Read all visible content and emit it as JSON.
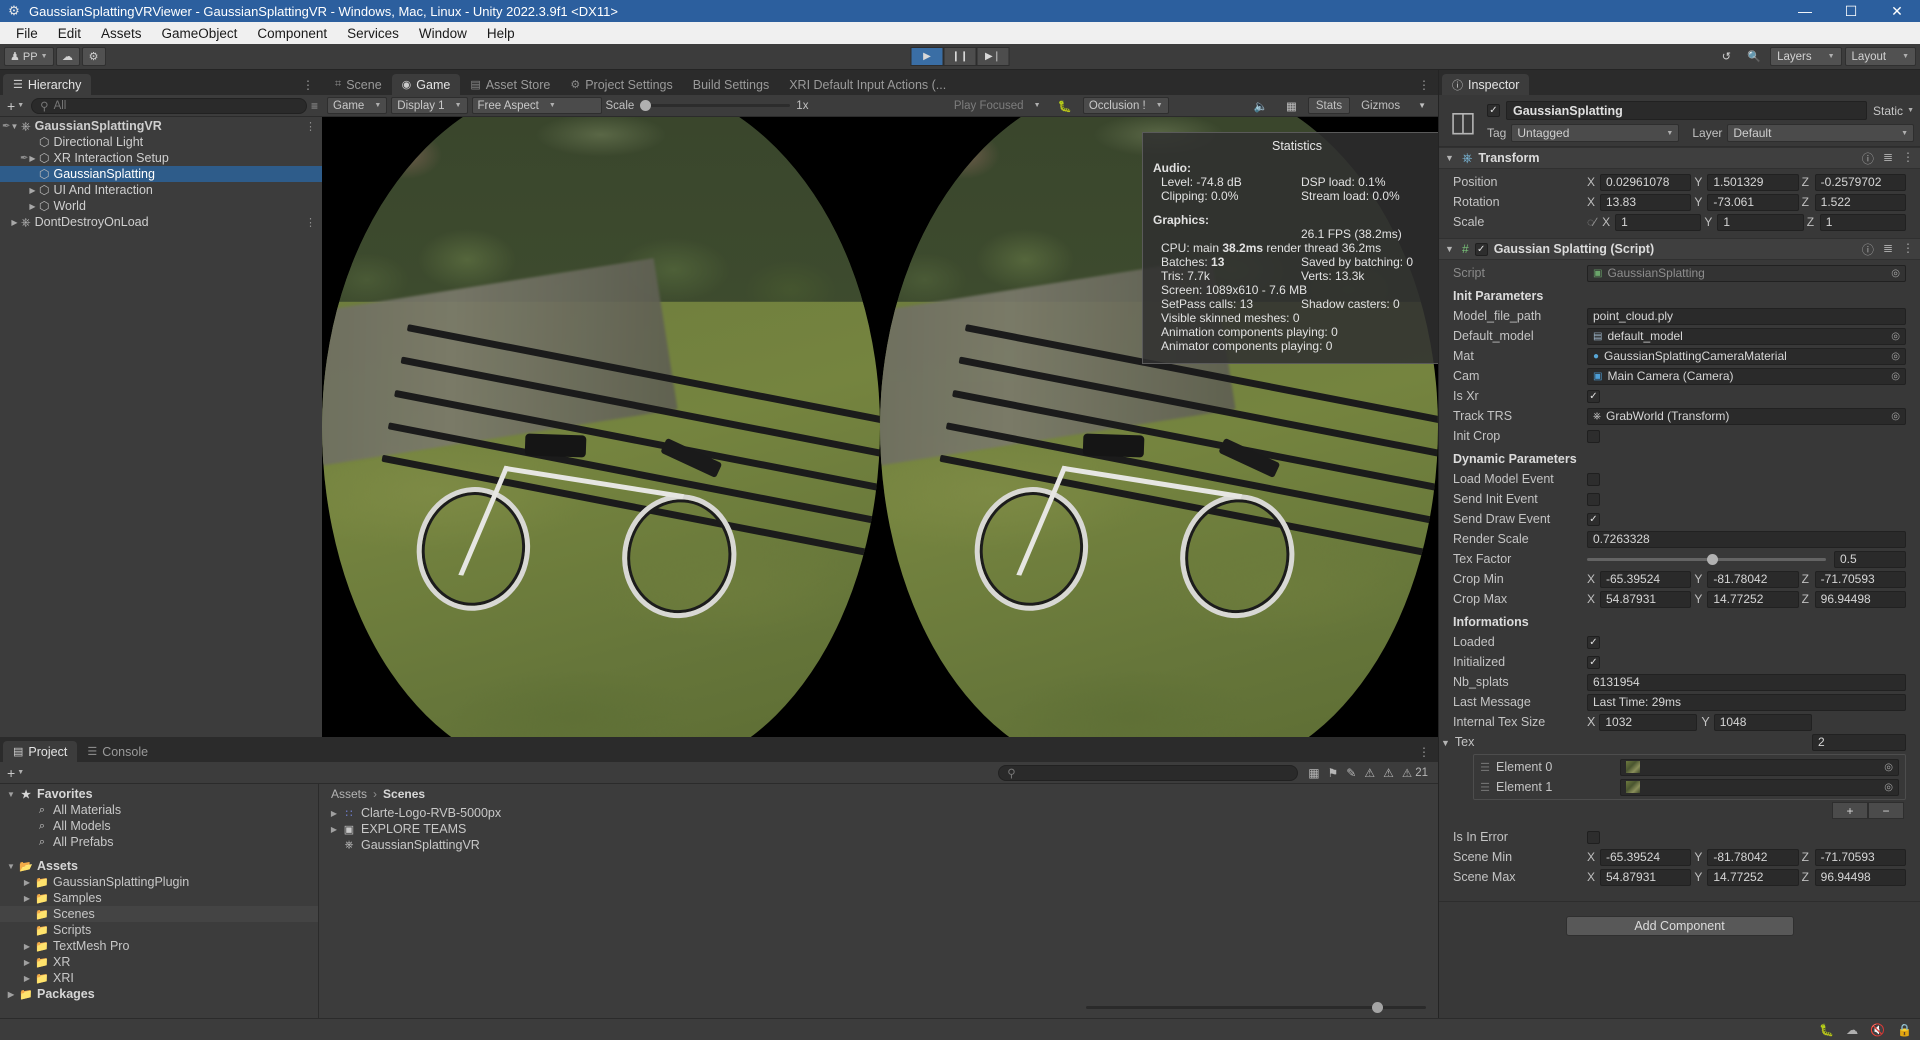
{
  "window": {
    "title": "GaussianSplattingVRViewer - GaussianSplattingVR - Windows, Mac, Linux - Unity 2022.3.9f1 <DX11>",
    "app_icon": "unity-icon",
    "minimize": "—",
    "maximize": "☐",
    "close": "✕"
  },
  "menu": {
    "items": [
      "File",
      "Edit",
      "Assets",
      "GameObject",
      "Component",
      "Services",
      "Window",
      "Help"
    ]
  },
  "toolbar": {
    "account_label": "PP",
    "cloud_icon": "cloud-icon",
    "settings_icon": "gear-icon",
    "play": "▶",
    "pause": "❙❙",
    "step": "▶❘",
    "undo_icon": "undo-history-icon",
    "search_icon": "search-icon",
    "layers_label": "Layers",
    "layout_label": "Layout"
  },
  "hierarchy": {
    "tab_label": "Hierarchy",
    "tab_icon": "hierarchy-icon",
    "add_label": "+",
    "search_placeholder": "All",
    "items": [
      {
        "label": "GaussianSplattingVR",
        "depth": 0,
        "icon": "unity-scene-icon",
        "expanded": true,
        "selected": false,
        "bold": true,
        "prefab": true,
        "menu": true
      },
      {
        "label": "Directional Light",
        "depth": 1,
        "icon": "gameobject-icon",
        "expanded": null,
        "selected": false,
        "bold": false,
        "prefab": false,
        "menu": false
      },
      {
        "label": "XR Interaction Setup",
        "depth": 1,
        "icon": "gameobject-icon",
        "expanded": false,
        "selected": false,
        "bold": false,
        "prefab": true,
        "menu": false
      },
      {
        "label": "GaussianSplatting",
        "depth": 1,
        "icon": "gameobject-icon",
        "expanded": null,
        "selected": true,
        "bold": false,
        "prefab": false,
        "menu": false
      },
      {
        "label": "UI And Interaction",
        "depth": 1,
        "icon": "gameobject-icon",
        "expanded": false,
        "selected": false,
        "bold": false,
        "prefab": false,
        "menu": false
      },
      {
        "label": "World",
        "depth": 1,
        "icon": "gameobject-icon",
        "expanded": false,
        "selected": false,
        "bold": false,
        "prefab": false,
        "menu": false
      },
      {
        "label": "DontDestroyOnLoad",
        "depth": 0,
        "icon": "unity-scene-icon",
        "expanded": false,
        "selected": false,
        "bold": false,
        "prefab": false,
        "menu": true
      }
    ]
  },
  "center_tabs": [
    {
      "label": "Scene",
      "icon": "scene-icon",
      "active": false
    },
    {
      "label": "Game",
      "icon": "game-icon",
      "active": true
    },
    {
      "label": "Asset Store",
      "icon": "asset-store-icon",
      "active": false
    },
    {
      "label": "Project Settings",
      "icon": "project-settings-icon",
      "active": false
    },
    {
      "label": "Build Settings",
      "icon": "",
      "active": false
    },
    {
      "label": "XRI Default Input Actions (...",
      "icon": "",
      "active": false
    }
  ],
  "game_toolbar": {
    "mode": "Game",
    "display": "Display 1",
    "aspect": "Free Aspect",
    "scale_label": "Scale",
    "scale_value": "1x",
    "play_focused": "Play Focused",
    "mute_icon": "mute-audio-icon",
    "gizmo_grid_icon": "frame-debugger-icon",
    "stats_label": "Stats",
    "gizmos_label": "Gizmos",
    "occlusion": "Occlusion !",
    "bug_icon": "bug-icon"
  },
  "statistics": {
    "title": "Statistics",
    "audio_header": "Audio:",
    "audio_level": "Level: -74.8 dB",
    "audio_clipping": "Clipping: 0.0%",
    "dsp_load": "DSP load: 0.1%",
    "stream_load": "Stream load: 0.0%",
    "graphics_header": "Graphics:",
    "fps": "26.1 FPS (38.2ms)",
    "cpu_prefix": "CPU: main ",
    "cpu_main": "38.2ms",
    "cpu_suffix": " render thread 36.2ms",
    "batches_prefix": "Batches: ",
    "batches_value": "13",
    "saved_batching": "Saved by batching: 0",
    "tris": "Tris: 7.7k",
    "verts": "Verts: 13.3k",
    "screen": "Screen: 1089x610 - 7.6 MB",
    "setpass": "SetPass calls: 13",
    "shadow_casters": "Shadow casters: 0",
    "skinned_meshes": "Visible skinned meshes: 0",
    "anim_components": "Animation components playing: 0",
    "animator_components": "Animator components playing: 0"
  },
  "project": {
    "tabs": [
      {
        "label": "Project",
        "icon": "folder-icon",
        "active": true
      },
      {
        "label": "Console",
        "icon": "console-icon",
        "active": false
      }
    ],
    "search_placeholder": "",
    "tree": [
      {
        "label": "Favorites",
        "depth": 0,
        "icon": "star-icon",
        "tri": "▼",
        "bold": true,
        "hl": false
      },
      {
        "label": "All Materials",
        "depth": 1,
        "icon": "search-icon",
        "tri": "",
        "bold": false,
        "hl": false
      },
      {
        "label": "All Models",
        "depth": 1,
        "icon": "search-icon",
        "tri": "",
        "bold": false,
        "hl": false
      },
      {
        "label": "All Prefabs",
        "depth": 1,
        "icon": "search-icon",
        "tri": "",
        "bold": false,
        "hl": false
      },
      {
        "label": "",
        "depth": 0,
        "icon": "",
        "tri": "",
        "bold": false,
        "hl": false
      },
      {
        "label": "Assets",
        "depth": 0,
        "icon": "folder-open-icon",
        "tri": "▼",
        "bold": true,
        "hl": false
      },
      {
        "label": "GaussianSplattingPlugin",
        "depth": 1,
        "icon": "folder-icon",
        "tri": "▶",
        "bold": false,
        "hl": false
      },
      {
        "label": "Samples",
        "depth": 1,
        "icon": "folder-icon",
        "tri": "▶",
        "bold": false,
        "hl": false
      },
      {
        "label": "Scenes",
        "depth": 1,
        "icon": "folder-icon",
        "tri": "",
        "bold": false,
        "hl": true
      },
      {
        "label": "Scripts",
        "depth": 1,
        "icon": "folder-icon",
        "tri": "",
        "bold": false,
        "hl": false
      },
      {
        "label": "TextMesh Pro",
        "depth": 1,
        "icon": "folder-icon",
        "tri": "▶",
        "bold": false,
        "hl": false
      },
      {
        "label": "XR",
        "depth": 1,
        "icon": "folder-icon",
        "tri": "▶",
        "bold": false,
        "hl": false
      },
      {
        "label": "XRI",
        "depth": 1,
        "icon": "folder-icon",
        "tri": "▶",
        "bold": false,
        "hl": false
      },
      {
        "label": "Packages",
        "depth": 0,
        "icon": "folder-icon",
        "tri": "▶",
        "bold": true,
        "hl": false
      }
    ],
    "breadcrumb": [
      "Assets",
      "Scenes"
    ],
    "assets": [
      {
        "label": "Clarte-Logo-RVB-5000px",
        "icon": "texture-icon",
        "tri": "▶"
      },
      {
        "label": "EXPLORE TEAMS",
        "icon": "image-icon",
        "tri": "▶"
      },
      {
        "label": "GaussianSplattingVR",
        "icon": "unity-scene-icon",
        "tri": ""
      }
    ],
    "warning_count": "21"
  },
  "inspector": {
    "tab_label": "Inspector",
    "tab_icon": "inspector-icon",
    "object_name": "GaussianSplatting",
    "enabled": true,
    "static_label": "Static",
    "tag_label": "Tag",
    "tag_value": "Untagged",
    "layer_label": "Layer",
    "layer_value": "Default",
    "transform": {
      "title": "Transform",
      "icon": "transform-icon",
      "rows": [
        {
          "label": "Position",
          "x": "0.02961078",
          "y": "1.501329",
          "z": "-0.2579702"
        },
        {
          "label": "Rotation",
          "x": "13.83",
          "y": "-73.061",
          "z": "1.522"
        },
        {
          "label": "Scale",
          "x": "1",
          "y": "1",
          "z": "1",
          "link_icon": "constrain-proportions-off-icon"
        }
      ]
    },
    "script_component": {
      "title": "Gaussian Splatting (Script)",
      "icon": "cs-script-icon",
      "enabled": true,
      "help_icon": "help-icon",
      "preset_icon": "preset-icon",
      "menu_icon": "more-menu-icon",
      "script_label": "Script",
      "script_value": "GaussianSplatting",
      "sections": {
        "init_parameters": "Init Parameters",
        "dynamic_parameters": "Dynamic Parameters",
        "informations": "Informations"
      },
      "fields": {
        "model_file_path": {
          "label": "Model_file_path",
          "value": "point_cloud.ply"
        },
        "default_model": {
          "label": "Default_model",
          "value": "default_model",
          "icon": "asset-icon"
        },
        "mat": {
          "label": "Mat",
          "value": "GaussianSplattingCameraMaterial",
          "icon": "material-icon"
        },
        "cam": {
          "label": "Cam",
          "value": "Main Camera (Camera)",
          "icon": "camera-icon"
        },
        "is_xr": {
          "label": "Is Xr",
          "checked": true
        },
        "track_trs": {
          "label": "Track TRS",
          "value": "GrabWorld (Transform)",
          "icon": "transform-icon"
        },
        "init_crop": {
          "label": "Init Crop",
          "checked": false
        },
        "load_model_event": {
          "label": "Load Model Event",
          "checked": false
        },
        "send_init_event": {
          "label": "Send Init Event",
          "checked": false
        },
        "send_draw_event": {
          "label": "Send Draw Event",
          "checked": true
        },
        "render_scale": {
          "label": "Render Scale",
          "value": "0.7263328"
        },
        "tex_factor": {
          "label": "Tex Factor",
          "value": "0.5"
        },
        "crop_min": {
          "label": "Crop Min",
          "x": "-65.39524",
          "y": "-81.78042",
          "z": "-71.70593"
        },
        "crop_max": {
          "label": "Crop Max",
          "x": "54.87931",
          "y": "14.77252",
          "z": "96.94498"
        },
        "loaded": {
          "label": "Loaded",
          "checked": true
        },
        "initialized": {
          "label": "Initialized",
          "checked": true
        },
        "nb_splats": {
          "label": "Nb_splats",
          "value": "6131954"
        },
        "last_message": {
          "label": "Last Message",
          "value": "Last Time: 29ms"
        },
        "internal_tex_size": {
          "label": "Internal Tex Size",
          "x": "1032",
          "y": "1048"
        },
        "tex": {
          "label": "Tex",
          "count": "2",
          "elements": [
            {
              "label": "Element 0"
            },
            {
              "label": "Element 1"
            }
          ],
          "add": "+",
          "remove": "−"
        },
        "is_in_error": {
          "label": "Is In Error",
          "checked": false
        },
        "scene_min": {
          "label": "Scene Min",
          "x": "-65.39524",
          "y": "-81.78042",
          "z": "-71.70593"
        },
        "scene_max": {
          "label": "Scene Max",
          "x": "54.87931",
          "y": "14.77252",
          "z": "96.94498"
        }
      }
    },
    "add_component": "Add Component"
  },
  "statusbar": {
    "message": "",
    "icons": [
      "bug-collapse-icon",
      "cloud-status-icon",
      "mute-status-icon",
      "lock-status-icon"
    ]
  },
  "colors": {
    "accent_blue": "#2c5f9e",
    "selection_blue": "#2e5c8a",
    "panel_bg": "#383838",
    "tab_bg": "#2b2b2b"
  }
}
